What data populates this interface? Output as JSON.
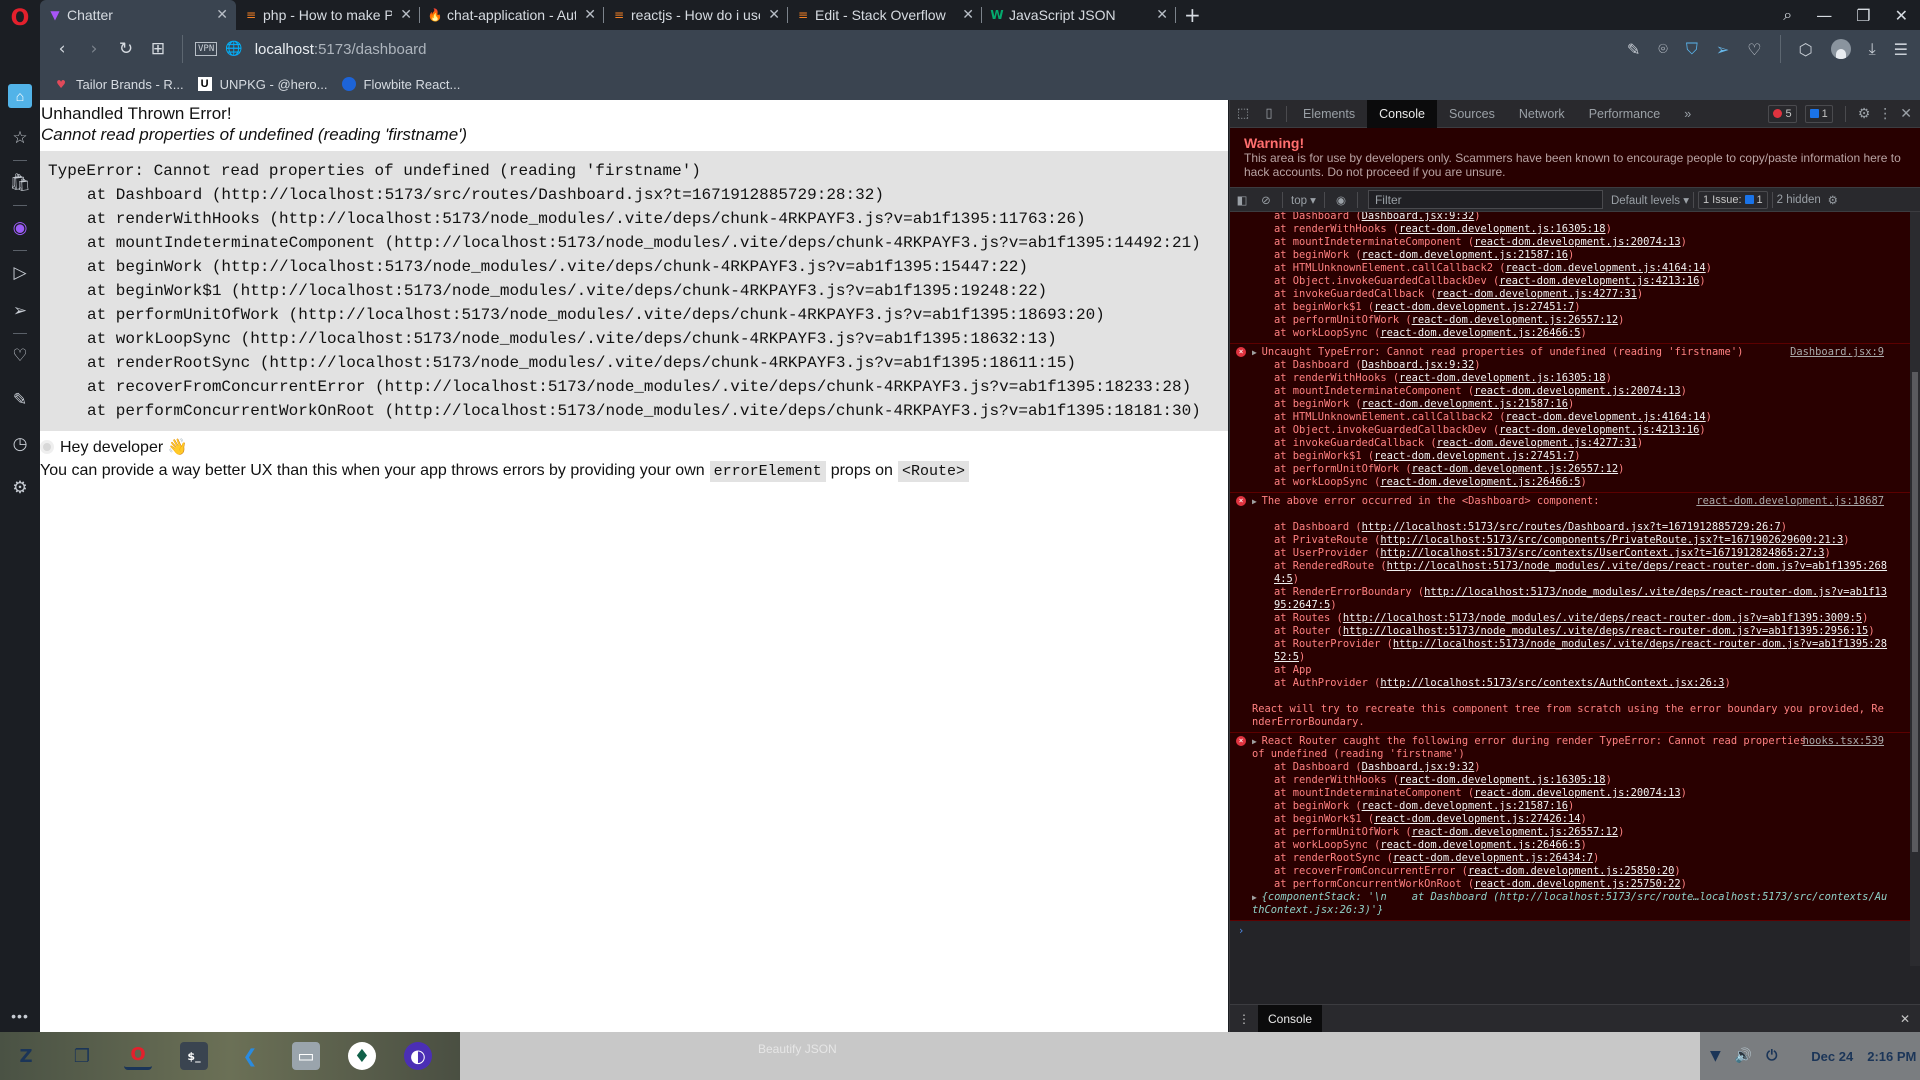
{
  "browser": {
    "tabs": [
      {
        "label": "Chatter",
        "icon": "vite-icon",
        "active": true
      },
      {
        "label": "php - How to make PDF",
        "icon": "stackoverflow-icon"
      },
      {
        "label": "chat-application - Auth",
        "icon": "firebase-icon"
      },
      {
        "label": "reactjs - How do i use",
        "icon": "stackoverflow-icon"
      },
      {
        "label": "Edit - Stack Overflow",
        "icon": "stackoverflow-icon"
      },
      {
        "label": "JavaScript JSON",
        "icon": "w3schools-icon"
      }
    ],
    "new_tab": "+",
    "address": {
      "host": "localhost",
      "rest": ":5173/dashboard",
      "vpn_label": "VPN"
    },
    "bookmarks": [
      {
        "label": "Tailor Brands - R...",
        "icon": "tailor-brands-icon"
      },
      {
        "label": "UNPKG - @hero...",
        "icon": "unpkg-icon",
        "glyph": "U"
      },
      {
        "label": "Flowbite React...",
        "icon": "flowbite-icon"
      }
    ]
  },
  "page": {
    "title": "Unhandled Thrown Error!",
    "message": "Cannot read properties of undefined (reading 'firstname')",
    "stack_head": "TypeError: Cannot read properties of undefined (reading 'firstname')",
    "stack": [
      "at Dashboard (http://localhost:5173/src/routes/Dashboard.jsx?t=1671912885729:28:32)",
      "at renderWithHooks (http://localhost:5173/node_modules/.vite/deps/chunk-4RKPAYF3.js?v=ab1f1395:11763:26)",
      "at mountIndeterminateComponent (http://localhost:5173/node_modules/.vite/deps/chunk-4RKPAYF3.js?v=ab1f1395:14492:21)",
      "at beginWork (http://localhost:5173/node_modules/.vite/deps/chunk-4RKPAYF3.js?v=ab1f1395:15447:22)",
      "at beginWork$1 (http://localhost:5173/node_modules/.vite/deps/chunk-4RKPAYF3.js?v=ab1f1395:19248:22)",
      "at performUnitOfWork (http://localhost:5173/node_modules/.vite/deps/chunk-4RKPAYF3.js?v=ab1f1395:18693:20)",
      "at workLoopSync (http://localhost:5173/node_modules/.vite/deps/chunk-4RKPAYF3.js?v=ab1f1395:18632:13)",
      "at renderRootSync (http://localhost:5173/node_modules/.vite/deps/chunk-4RKPAYF3.js?v=ab1f1395:18611:15)",
      "at recoverFromConcurrentError (http://localhost:5173/node_modules/.vite/deps/chunk-4RKPAYF3.js?v=ab1f1395:18233:28)",
      "at performConcurrentWorkOnRoot (http://localhost:5173/node_modules/.vite/deps/chunk-4RKPAYF3.js?v=ab1f1395:18181:30)"
    ],
    "hey": "Hey developer 👋",
    "tip_pre": "You can provide a way better UX than this when your app throws errors by providing your own",
    "tip_code1": "errorElement",
    "tip_mid": "props on",
    "tip_code2": "<Route>"
  },
  "devtools": {
    "tabs": [
      "Elements",
      "Console",
      "Sources",
      "Network",
      "Performance"
    ],
    "more": "»",
    "error_count": "5",
    "issue_count": "1",
    "warning_title": "Warning!",
    "warning_body": "This area is for use by developers only. Scammers have been known to encourage people to copy/paste information here to hack accounts. Do not proceed if you are unsure.",
    "context": "top ▾",
    "filter_placeholder": "Filter",
    "levels": "Default levels ▾",
    "issues_label": "1 Issue:",
    "issues_n": "1",
    "hidden": "2 hidden",
    "drawer_tab": "Console",
    "messages": [
      {
        "head": "",
        "src": "",
        "lines": [
          [
            "at Dashboard (",
            "Dashboard.jsx:9:32",
            ")"
          ],
          [
            "at renderWithHooks (",
            "react-dom.development.js:16305:18",
            ")"
          ],
          [
            "at mountIndeterminateComponent (",
            "react-dom.development.js:20074:13",
            ")"
          ],
          [
            "at beginWork (",
            "react-dom.development.js:21587:16",
            ")"
          ],
          [
            "at HTMLUnknownElement.callCallback2 (",
            "react-dom.development.js:4164:14",
            ")"
          ],
          [
            "at Object.invokeGuardedCallbackDev (",
            "react-dom.development.js:4213:16",
            ")"
          ],
          [
            "at invokeGuardedCallback (",
            "react-dom.development.js:4277:31",
            ")"
          ],
          [
            "at beginWork$1 (",
            "react-dom.development.js:27451:7",
            ")"
          ],
          [
            "at performUnitOfWork (",
            "react-dom.development.js:26557:12",
            ")"
          ],
          [
            "at workLoopSync (",
            "react-dom.development.js:26466:5",
            ")"
          ]
        ]
      },
      {
        "head": "Uncaught TypeError: Cannot read properties of undefined (reading 'firstname')",
        "src": "Dashboard.jsx:9",
        "lines": [
          [
            "at Dashboard (",
            "Dashboard.jsx:9:32",
            ")"
          ],
          [
            "at renderWithHooks (",
            "react-dom.development.js:16305:18",
            ")"
          ],
          [
            "at mountIndeterminateComponent (",
            "react-dom.development.js:20074:13",
            ")"
          ],
          [
            "at beginWork (",
            "react-dom.development.js:21587:16",
            ")"
          ],
          [
            "at HTMLUnknownElement.callCallback2 (",
            "react-dom.development.js:4164:14",
            ")"
          ],
          [
            "at Object.invokeGuardedCallbackDev (",
            "react-dom.development.js:4213:16",
            ")"
          ],
          [
            "at invokeGuardedCallback (",
            "react-dom.development.js:4277:31",
            ")"
          ],
          [
            "at beginWork$1 (",
            "react-dom.development.js:27451:7",
            ")"
          ],
          [
            "at performUnitOfWork (",
            "react-dom.development.js:26557:12",
            ")"
          ],
          [
            "at workLoopSync (",
            "react-dom.development.js:26466:5",
            ")"
          ]
        ]
      },
      {
        "head": "The above error occurred in the <Dashboard> component:",
        "src": "react-dom.development.js:18687",
        "lines": [
          [
            "",
            "",
            ""
          ],
          [
            "at Dashboard (",
            "http://localhost:5173/src/routes/Dashboard.jsx?t=1671912885729:26:7",
            ")"
          ],
          [
            "at PrivateRoute (",
            "http://localhost:5173/src/components/PrivateRoute.jsx?t=1671902629600:21:3",
            ")"
          ],
          [
            "at UserProvider (",
            "http://localhost:5173/src/contexts/UserContext.jsx?t=1671912824865:27:3",
            ")"
          ],
          [
            "at RenderedRoute (",
            "http://localhost:5173/node_modules/.vite/deps/react-router-dom.js?v=ab1f1395:2684:5",
            ")"
          ],
          [
            "at RenderErrorBoundary (",
            "http://localhost:5173/node_modules/.vite/deps/react-router-dom.js?v=ab1f1395:2647:5",
            ")"
          ],
          [
            "at Routes (",
            "http://localhost:5173/node_modules/.vite/deps/react-router-dom.js?v=ab1f1395:3009:5",
            ")"
          ],
          [
            "at Router (",
            "http://localhost:5173/node_modules/.vite/deps/react-router-dom.js?v=ab1f1395:2956:15",
            ")"
          ],
          [
            "at RouterProvider (",
            "http://localhost:5173/node_modules/.vite/deps/react-router-dom.js?v=ab1f1395:2852:5",
            ")"
          ],
          [
            "at App",
            "",
            ""
          ],
          [
            "at AuthProvider (",
            "http://localhost:5173/src/contexts/AuthContext.jsx:26:3",
            ")"
          ]
        ],
        "tail": "React will try to recreate this component tree from scratch using the error boundary you provided, RenderErrorBoundary."
      },
      {
        "head": "React Router caught the following error during render TypeError: Cannot read properties of undefined (reading 'firstname')",
        "src": "hooks.tsx:539",
        "lines": [
          [
            "at Dashboard (",
            "Dashboard.jsx:9:32",
            ")"
          ],
          [
            "at renderWithHooks (",
            "react-dom.development.js:16305:18",
            ")"
          ],
          [
            "at mountIndeterminateComponent (",
            "react-dom.development.js:20074:13",
            ")"
          ],
          [
            "at beginWork (",
            "react-dom.development.js:21587:16",
            ")"
          ],
          [
            "at beginWork$1 (",
            "react-dom.development.js:27426:14",
            ")"
          ],
          [
            "at performUnitOfWork (",
            "react-dom.development.js:26557:12",
            ")"
          ],
          [
            "at workLoopSync (",
            "react-dom.development.js:26466:5",
            ")"
          ],
          [
            "at renderRootSync (",
            "react-dom.development.js:26434:7",
            ")"
          ],
          [
            "at recoverFromConcurrentError (",
            "react-dom.development.js:25850:20",
            ")"
          ],
          [
            "at performConcurrentWorkOnRoot (",
            "react-dom.development.js:25750:22",
            ")"
          ]
        ],
        "object": "{componentStack: '\\n    at Dashboard (http://localhost:5173/src/route…localhost:5173/src/contexts/AuthContext.jsx:26:3)'}"
      }
    ]
  },
  "taskbar": {
    "window_title": "Beautify JSON",
    "date": "Dec 24",
    "time": "2:16 PM"
  }
}
